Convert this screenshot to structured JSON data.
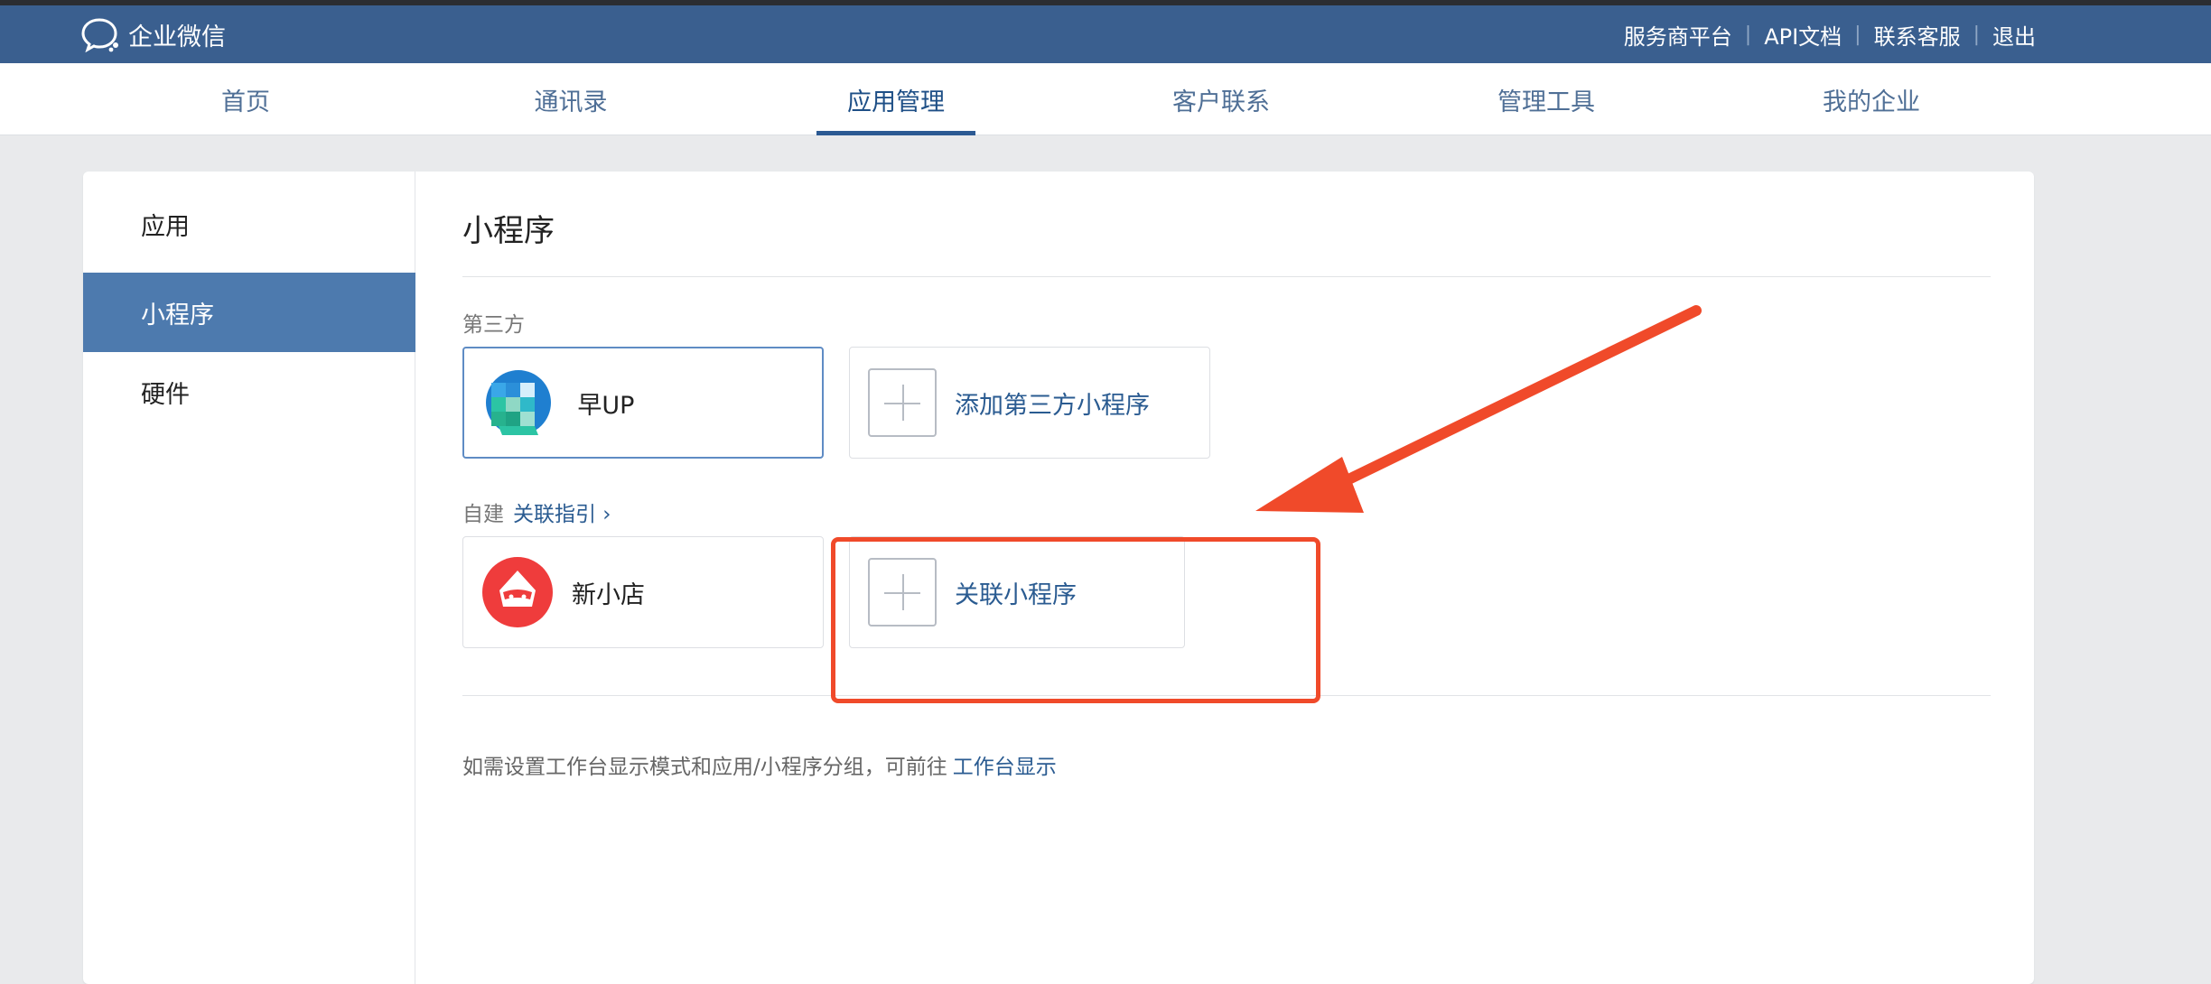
{
  "header": {
    "brand": "企业微信",
    "links": [
      "服务商平台",
      "API文档",
      "联系客服",
      "退出"
    ]
  },
  "nav": {
    "items": [
      "首页",
      "通讯录",
      "应用管理",
      "客户联系",
      "管理工具",
      "我的企业"
    ],
    "active_index": 2
  },
  "sidebar": {
    "items": [
      "应用",
      "小程序",
      "硬件"
    ],
    "active_index": 1
  },
  "main": {
    "title": "小程序",
    "third_party_label": "第三方",
    "third_party_app_name": " 早UP",
    "add_third_party_label": "添加第三方小程序",
    "self_built_label": "自建",
    "guide_link": "关联指引 ›",
    "self_built_app_name": "新小店",
    "link_mini_program_label": "关联小程序",
    "footnote_text": "如需设置工作台显示模式和应用/小程序分组，可前往",
    "footnote_link": "工作台显示"
  },
  "colors": {
    "topbar": "#3a5f8f",
    "sidebar_active": "#4d7aae",
    "link": "#2a5b91",
    "annotation": "#f04a2a"
  }
}
